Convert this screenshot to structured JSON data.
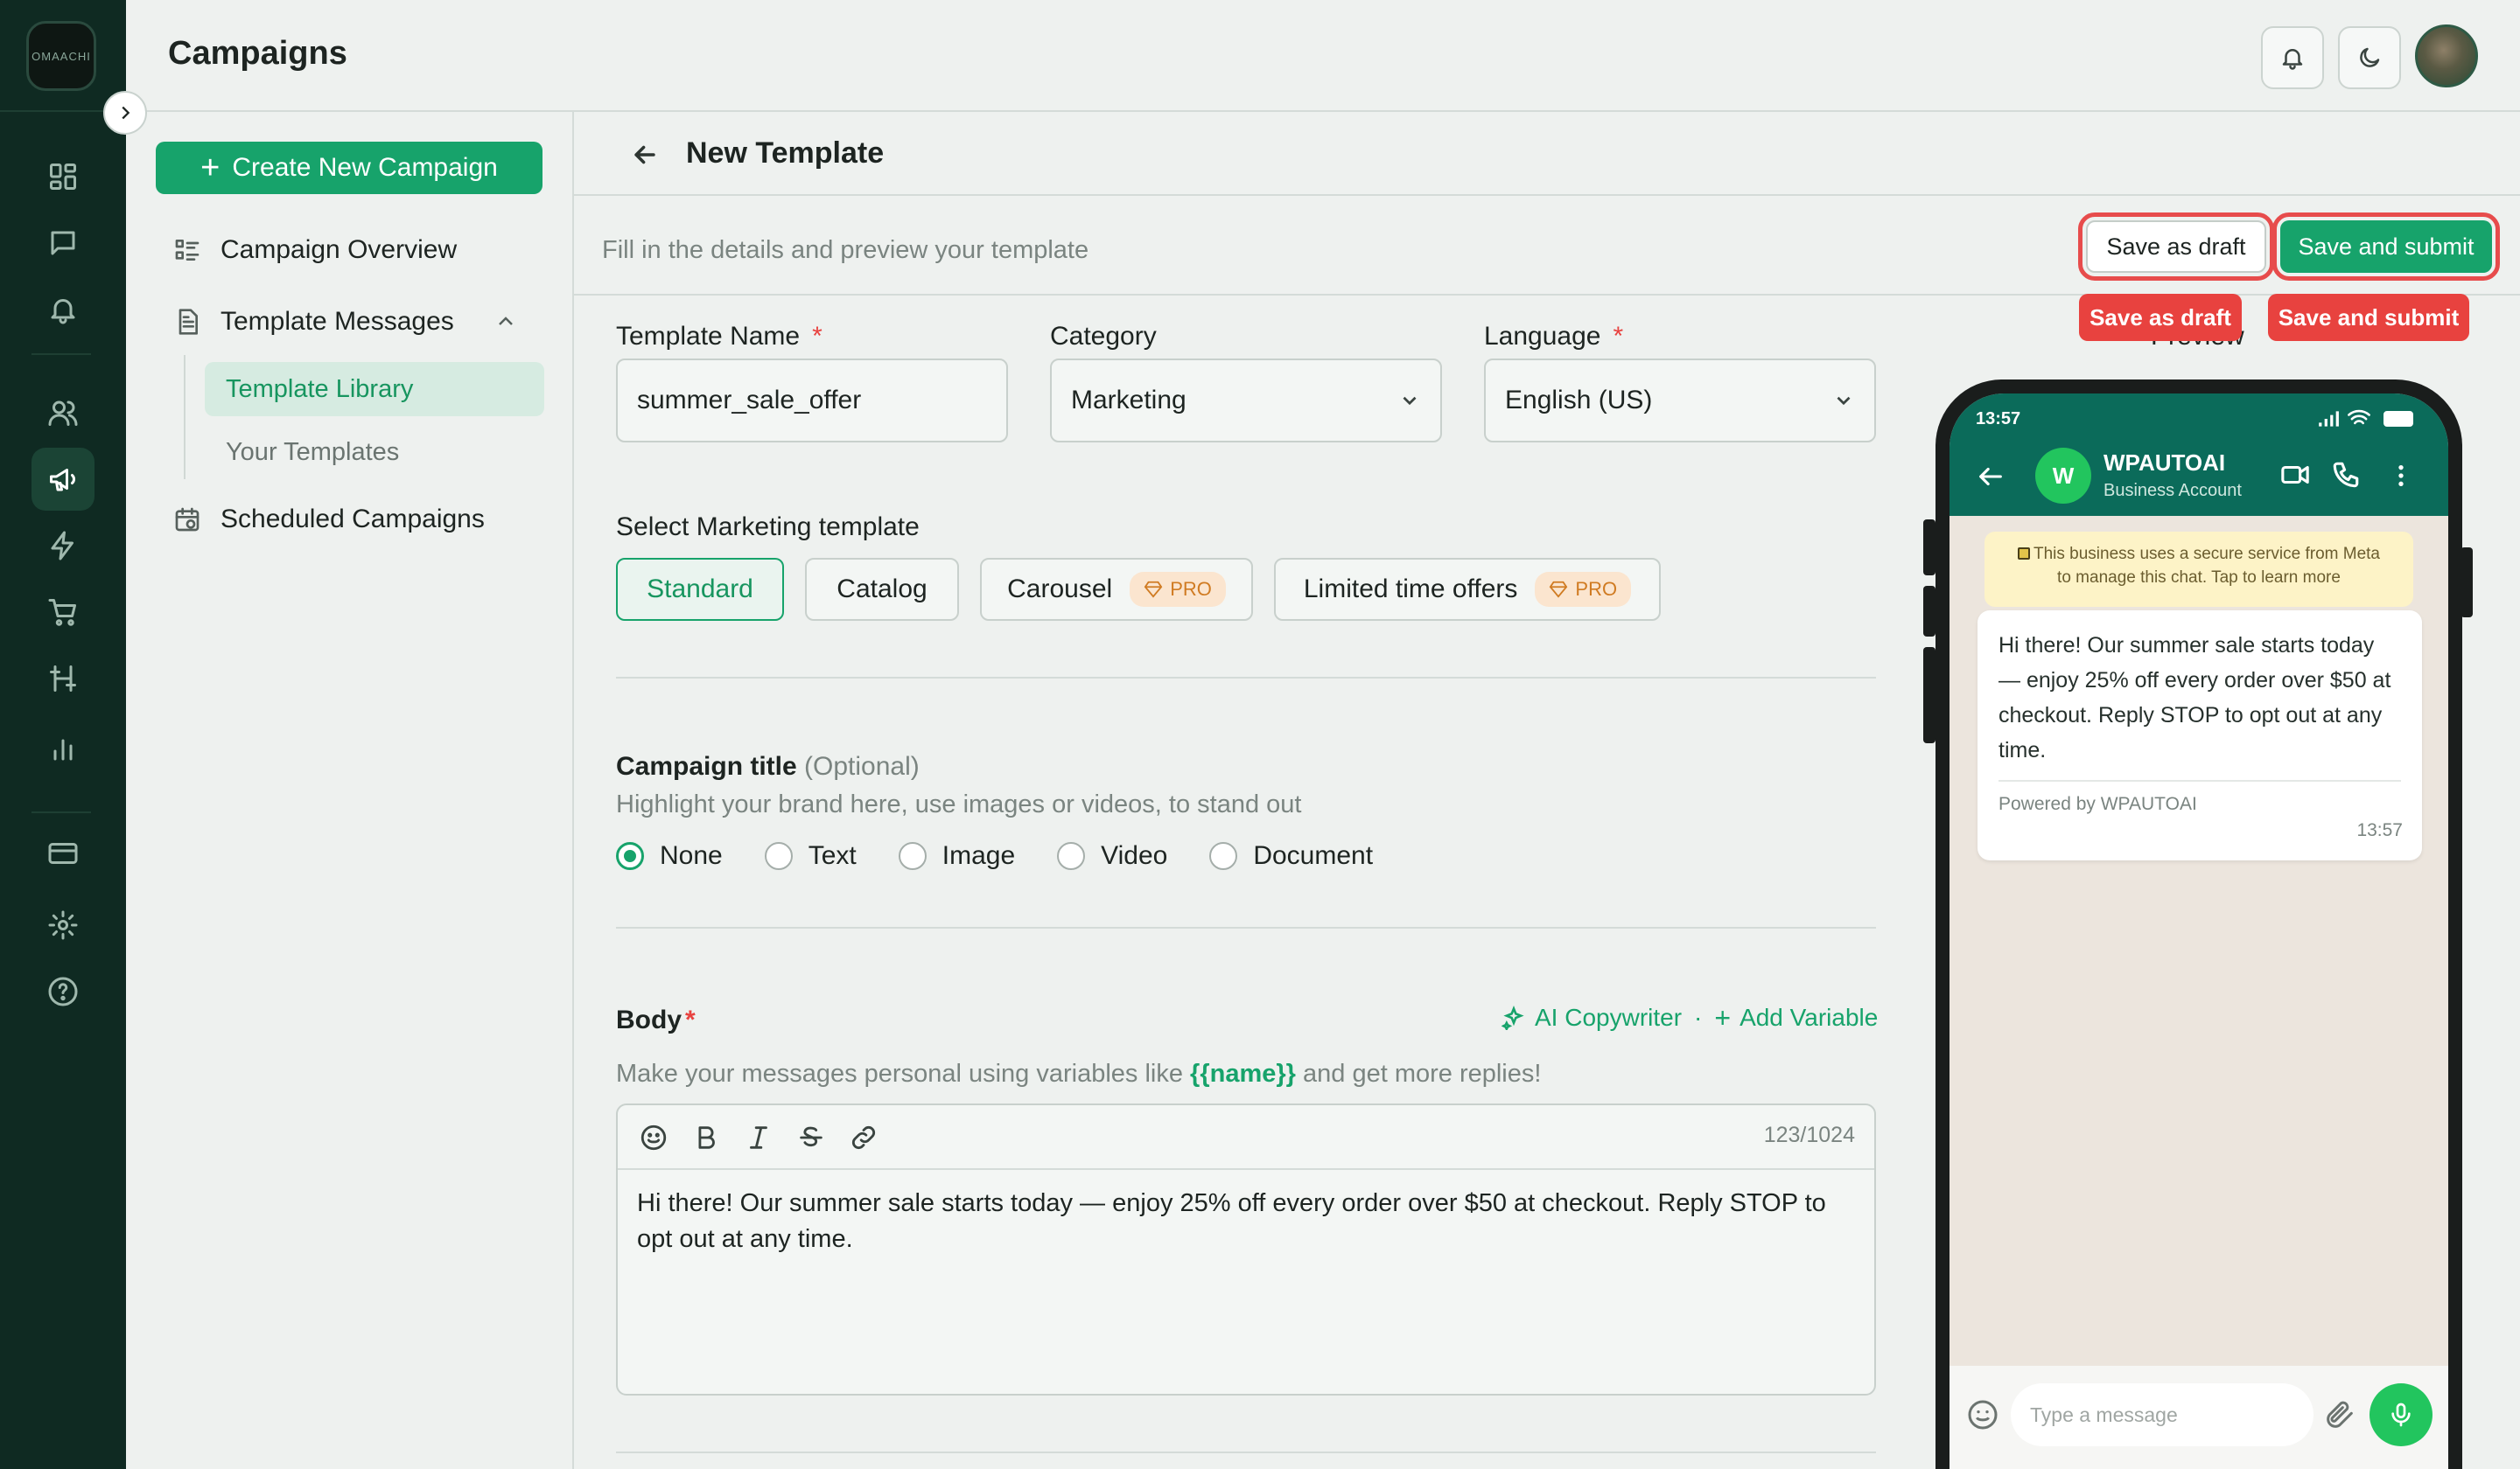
{
  "app": {
    "logo_text": "OMAACHI",
    "page_title": "Campaigns"
  },
  "sidebar": {
    "create_label": "Create New Campaign",
    "items": [
      {
        "label": "Campaign Overview"
      },
      {
        "label": "Template Messages"
      },
      {
        "label": "Scheduled Campaigns"
      }
    ],
    "sub_items": [
      {
        "label": "Template Library"
      },
      {
        "label": "Your Templates"
      }
    ]
  },
  "main": {
    "title": "New Template",
    "subtitle": "Fill in the details and preview your template",
    "save_draft_label": "Save as draft",
    "save_submit_label": "Save and submit",
    "draft_tag": "Save as draft",
    "submit_tag": "Save and submit",
    "preview_label": "Preview",
    "fields": {
      "template_name_label": "Template Name",
      "template_name_value": "summer_sale_offer",
      "category_label": "Category",
      "category_value": "Marketing",
      "language_label": "Language",
      "language_value": "English (US)",
      "required_mark": "*"
    },
    "marketing": {
      "label": "Select Marketing template",
      "options": [
        "Standard",
        "Catalog",
        "Carousel",
        "Limited time offers"
      ],
      "pro_badge": "PRO"
    },
    "campaign_title": {
      "label": "Campaign title",
      "optional": "(Optional)",
      "hint": "Highlight your brand here, use images or videos, to stand out",
      "options": [
        "None",
        "Text",
        "Image",
        "Video",
        "Document"
      ],
      "selected": "None"
    },
    "body": {
      "label": "Body",
      "ai_label": "AI Copywriter",
      "separator": "·",
      "add_var_label": "Add Variable",
      "hint_before": "Make your messages personal using variables like ",
      "hint_var": "{{name}}",
      "hint_after": " and get more replies!",
      "counter": "123/1024",
      "text": "Hi there! Our summer sale starts today — enjoy 25% off every order over $50 at checkout. Reply STOP to opt out at any time."
    }
  },
  "preview": {
    "time": "13:57",
    "avatar_letter": "W",
    "name": "WPAUTOAI",
    "account_type": "Business Account",
    "notice_line1": "This business uses a secure service from Meta",
    "notice_line2": "to manage this chat. Tap to learn more",
    "message": "Hi there! Our summer sale starts today — enjoy 25% off every order over $50 at checkout. Reply STOP to opt out at any time.",
    "powered_by": "Powered by WPAUTOAI",
    "message_time": "13:57",
    "input_placeholder": "Type a message"
  },
  "colors": {
    "accent": "#17a36b",
    "rail": "#0f2a22",
    "highlight": "#e8423f",
    "wa_header": "#0b6b5a"
  }
}
